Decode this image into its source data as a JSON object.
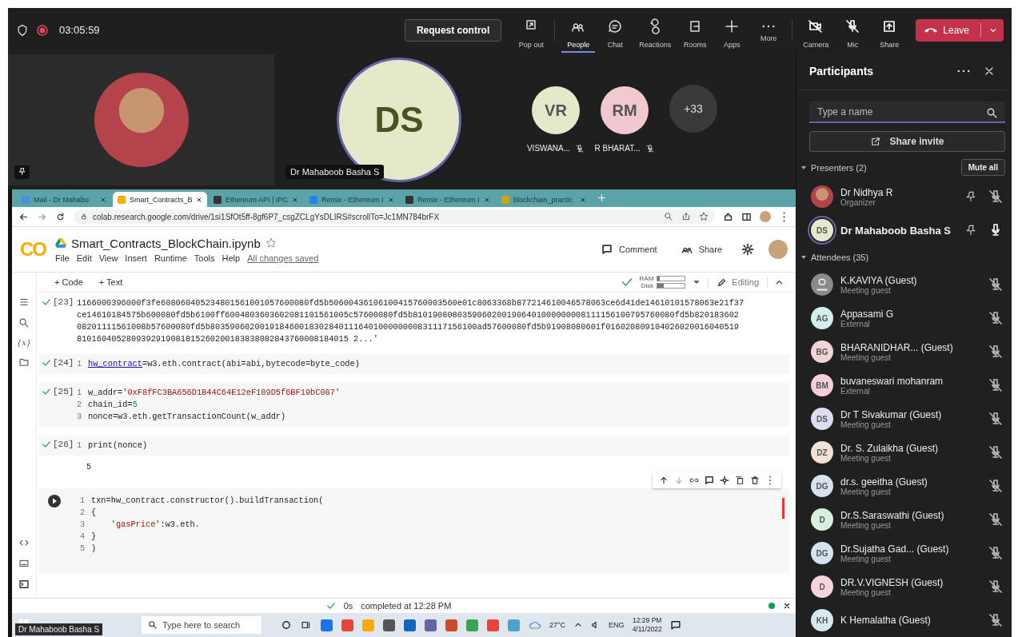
{
  "top_bar": {
    "timer": "03:05:59",
    "request_control": "Request control",
    "actions": [
      {
        "label": "Pop out",
        "selected": false
      },
      {
        "label": "People",
        "selected": true
      },
      {
        "label": "Chat",
        "selected": false
      },
      {
        "label": "Reactions",
        "selected": false
      },
      {
        "label": "Rooms",
        "selected": false
      },
      {
        "label": "Apps",
        "selected": false
      },
      {
        "label": "More",
        "selected": false
      }
    ],
    "devices": [
      {
        "label": "Camera"
      },
      {
        "label": "Mic"
      },
      {
        "label": "Share"
      }
    ],
    "leave": "Leave"
  },
  "video": {
    "speaker": {
      "initials": "DS",
      "name": "Dr Mahaboob Basha S"
    },
    "tiles": [
      {
        "initials": "VR",
        "name": "VISWANA...",
        "color": "#e5e8c9"
      },
      {
        "initials": "RM",
        "name": "R BHARAT...",
        "color": "#f2c8cf"
      }
    ],
    "overflow": "+33"
  },
  "browser": {
    "tabs": [
      {
        "label": "Mail - Dr Mahabo",
        "selected": false
      },
      {
        "label": "Smart_Contracts_B",
        "selected": true
      },
      {
        "label": "Ethereum API | IPC",
        "selected": false
      },
      {
        "label": "Remix - Ethereum I",
        "selected": false
      },
      {
        "label": "Remix - Ethereum I",
        "selected": false
      },
      {
        "label": "blockchain_practic",
        "selected": false
      }
    ],
    "url": "colab.research.google.com/drive/1si1SfOt5ff-8gf6P7_csgZCLgYsDLIRS#scrollTo=Jc1MN784brFX"
  },
  "colab": {
    "logo": "CO",
    "title": "Smart_Contracts_BlockChain.ipynb",
    "menu": [
      "File",
      "Edit",
      "View",
      "Insert",
      "Runtime",
      "Tools",
      "Help"
    ],
    "saved": "All changes saved",
    "comment": "Comment",
    "share": "Share",
    "add_code": "+ Code",
    "add_text": "+ Text",
    "ram": "RAM",
    "disk": "Disk",
    "editing": "Editing",
    "cells": [
      {
        "kind": "output",
        "number": "[23]",
        "lines": [
          {
            "parts": [
              {
                "text": "1166000396000f3fe608060405234801561001057600080fd5b50600436106100415760003560e01c8063368b877214610046578063ce6d41de14610101578063e21f37",
                "kind": "plain"
              }
            ]
          },
          {
            "parts": [
              {
                "text": "ce14610184575b600080fd5b6100ff6004803603602081101561005c57600080fd5b81019080803590602001906401000000008111156100795760080fd5b820183602",
                "kind": "plain"
              }
            ]
          },
          {
            "parts": [
              {
                "text": "08201111561008b57600080fd5b803590602001918460018302840111640100000000831117156100ad57600080fd5b91908080601f016020809104026020016040519",
                "kind": "plain"
              }
            ]
          },
          {
            "parts": [
              {
                "text": "8101604052809392919081815260200183838082843760008184015 2...'",
                "kind": "plain"
              }
            ]
          }
        ]
      },
      {
        "kind": "code",
        "number": "[24]",
        "lines": [
          {
            "no": "1",
            "parts": [
              {
                "text": "hw_contract",
                "kind": "link"
              },
              {
                "text": "=w3.eth.contract(abi=abi,bytecode=byte_code)",
                "kind": "plain"
              }
            ]
          }
        ]
      },
      {
        "kind": "code",
        "number": "[25]",
        "lines": [
          {
            "no": "1",
            "parts": [
              {
                "text": "w_addr=",
                "kind": "plain"
              },
              {
                "text": "'0xF8fFC3BA656D1B44C64E12eF189D5f6BF19bC087'",
                "kind": "string"
              }
            ]
          },
          {
            "no": "2",
            "parts": [
              {
                "text": "chain_id=",
                "kind": "plain"
              },
              {
                "text": "5",
                "kind": "number"
              }
            ]
          },
          {
            "no": "3",
            "parts": [
              {
                "text": "nonce=w3.eth.getTransactionCount(w_addr)",
                "kind": "plain"
              }
            ]
          }
        ]
      },
      {
        "kind": "code",
        "number": "[26]",
        "lines": [
          {
            "no": "1",
            "parts": [
              {
                "text": "print(nonce)",
                "kind": "plain"
              }
            ]
          }
        ],
        "output": "5"
      },
      {
        "kind": "running",
        "lines": [
          {
            "no": "1",
            "parts": [
              {
                "text": "txn=hw_contract.constructor().buildTransaction(",
                "kind": "plain"
              }
            ]
          },
          {
            "no": "2",
            "parts": [
              {
                "text": "{",
                "kind": "plain"
              }
            ]
          },
          {
            "no": "3",
            "parts": [
              {
                "text": "    'gasPrice'",
                "kind": "string"
              },
              {
                "text": ":w3.eth.",
                "kind": "plain"
              }
            ]
          },
          {
            "no": "4",
            "parts": [
              {
                "text": "}",
                "kind": "plain"
              }
            ]
          },
          {
            "no": "5",
            "parts": [
              {
                "text": ")",
                "kind": "plain"
              }
            ]
          }
        ]
      }
    ],
    "variables_glyph": "{x}",
    "status_time": "0s",
    "status": "completed at 12:28 PM"
  },
  "taskbar": {
    "search": "Type here to search",
    "weather": "27°C",
    "language": "ENG",
    "time": "12:29 PM",
    "date": "4/11/2022"
  },
  "screen_owner": "Dr Mahaboob Basha S",
  "participants": {
    "title": "Participants",
    "search_placeholder": "Type a name",
    "share_invite": "Share invite",
    "mute_all": "Mute all",
    "sections": [
      {
        "label": "Presenters (2)",
        "people": [
          {
            "name": "Dr Nidhya R",
            "role": "Organizer",
            "kind": "photo",
            "muted": true,
            "speaking": false
          },
          {
            "name": "Dr Mahaboob Basha S",
            "initials": "DS",
            "kind": "initials",
            "color": "#e5e8c9",
            "muted": false,
            "speaking": true
          }
        ]
      },
      {
        "label": "Attendees (35)",
        "people": [
          {
            "name": "K.KAVIYA (Guest)",
            "role": "Meeting guest",
            "kind": "generic",
            "muted": true,
            "speaking": false
          },
          {
            "name": "Appasami G",
            "role": "External",
            "initials": "AG",
            "kind": "initials",
            "color": "#d4eeee",
            "muted": true,
            "speaking": false
          },
          {
            "name": "BHARANIDHAR...  (Guest)",
            "role": "Meeting guest",
            "initials": "BG",
            "kind": "initials",
            "color": "#f0d4d6",
            "muted": true,
            "speaking": false
          },
          {
            "name": "buvaneswari mohanram",
            "role": "External",
            "initials": "BM",
            "kind": "initials",
            "color": "#f5cddd",
            "muted": true,
            "speaking": false
          },
          {
            "name": "Dr T Sivakumar (Guest)",
            "role": "Meeting guest",
            "initials": "DS",
            "kind": "initials",
            "color": "#dcdcf4",
            "muted": true,
            "speaking": false
          },
          {
            "name": "Dr. S. Zulaikha (Guest)",
            "role": "Meeting guest",
            "initials": "DZ",
            "kind": "initials",
            "color": "#f1e2d8",
            "muted": true,
            "speaking": false
          },
          {
            "name": "dr.s. geeitha (Guest)",
            "role": "Meeting guest",
            "initials": "DG",
            "kind": "initials",
            "color": "#d6e3ee",
            "muted": true,
            "speaking": false
          },
          {
            "name": "Dr.S.Saraswathi (Guest)",
            "role": "Meeting guest",
            "initials": "D",
            "kind": "initials",
            "color": "#d6f0dc",
            "muted": true,
            "speaking": false
          },
          {
            "name": "Dr.Sujatha Gad...  (Guest)",
            "role": "Meeting guest",
            "initials": "DG",
            "kind": "initials",
            "color": "#d6e3ee",
            "muted": true,
            "speaking": false
          },
          {
            "name": "DR.V.VIGNESH (Guest)",
            "role": "Meeting guest",
            "initials": "D",
            "kind": "initials",
            "color": "#f5d6d8",
            "muted": true,
            "speaking": false
          },
          {
            "name": "K Hemalatha (Guest)",
            "initials": "KH",
            "kind": "initials",
            "color": "#d6e8f0",
            "muted": true,
            "speaking": false
          }
        ]
      }
    ]
  }
}
